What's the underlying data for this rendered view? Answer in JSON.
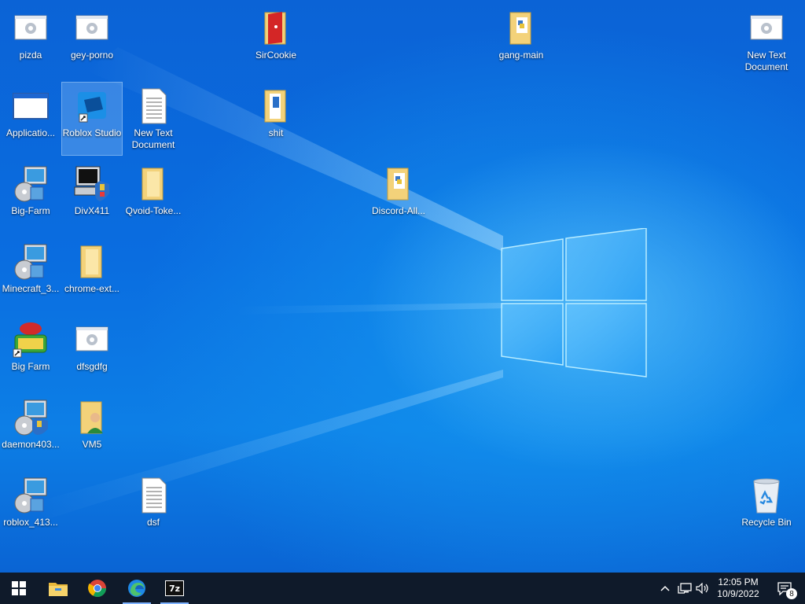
{
  "desktop": {
    "icons": [
      {
        "label": "pizda"
      },
      {
        "label": "gey-porno"
      },
      {
        "label": "SirCookie"
      },
      {
        "label": "gang-main"
      },
      {
        "label": "New Text Document"
      },
      {
        "label": "Applicatio..."
      },
      {
        "label": "Roblox Studio"
      },
      {
        "label": "New Text Document"
      },
      {
        "label": "shit"
      },
      {
        "label": "Big-Farm"
      },
      {
        "label": "DivX411"
      },
      {
        "label": "Qvoid-Toke..."
      },
      {
        "label": "Discord-All..."
      },
      {
        "label": "Minecraft_3..."
      },
      {
        "label": "chrome-ext..."
      },
      {
        "label": "Big Farm"
      },
      {
        "label": "dfsgdfg"
      },
      {
        "label": "daemon403..."
      },
      {
        "label": "VM5"
      },
      {
        "label": "roblox_413..."
      },
      {
        "label": "dsf"
      },
      {
        "label": "Recycle Bin"
      }
    ]
  },
  "taskbar": {
    "pinned": [
      "start-icon",
      "file-explorer-icon",
      "chrome-icon",
      "edge-icon",
      "seven-zip-icon"
    ],
    "seven_zip_text": "7z",
    "clock": {
      "time": "12:05 PM",
      "date": "10/9/2022"
    },
    "notification_count": "8"
  },
  "colors": {
    "taskbar": "#0f1a2a",
    "accent": "#0a6de0"
  }
}
